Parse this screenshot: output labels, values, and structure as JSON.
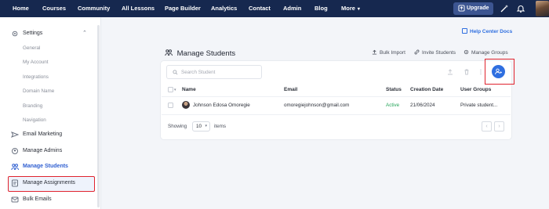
{
  "topnav": {
    "items": [
      "Home",
      "Courses",
      "Community",
      "All Lessons",
      "Page Builder",
      "Analytics",
      "Contact",
      "Admin",
      "Blog",
      "More"
    ],
    "upgrade_label": "Upgrade",
    "icons": [
      "magic-wand-icon",
      "bell-icon"
    ],
    "background": "#16284f"
  },
  "sidebar": {
    "settings": {
      "label": "Settings",
      "subitems": [
        "General",
        "My Account",
        "Integrations",
        "Domain Name",
        "Branding",
        "Navigation"
      ]
    },
    "items": [
      {
        "label": "Email Marketing",
        "icon": "email-icon"
      },
      {
        "label": "Manage Admins",
        "icon": "admin-gear-icon"
      },
      {
        "label": "Manage Students",
        "icon": "students-icon",
        "active": true
      },
      {
        "label": "Manage Assignments",
        "icon": "assignment-icon"
      },
      {
        "label": "Bulk Emails",
        "icon": "bulk-email-icon"
      }
    ]
  },
  "main": {
    "help_link": "Help Center Docs",
    "title": "Manage Students",
    "actions": [
      "Bulk Import",
      "Invite Students",
      "Manage Groups"
    ],
    "search_placeholder": "Search Student",
    "table": {
      "headers": [
        "Name",
        "Email",
        "Status",
        "Creation Date",
        "User Groups"
      ],
      "rows": [
        {
          "name": "Johnson Edosa Omoregie",
          "email": "omoregiejohnson@gmail.com",
          "status": "Active",
          "created": "21/06/2024",
          "groups": "Private student..."
        }
      ]
    },
    "pagination": {
      "showing_label": "Showing",
      "per_page": "10",
      "items_label": "items"
    }
  },
  "colors": {
    "accent": "#2f6fe0",
    "active_status": "#27a55b",
    "highlight": "#e0232e"
  }
}
